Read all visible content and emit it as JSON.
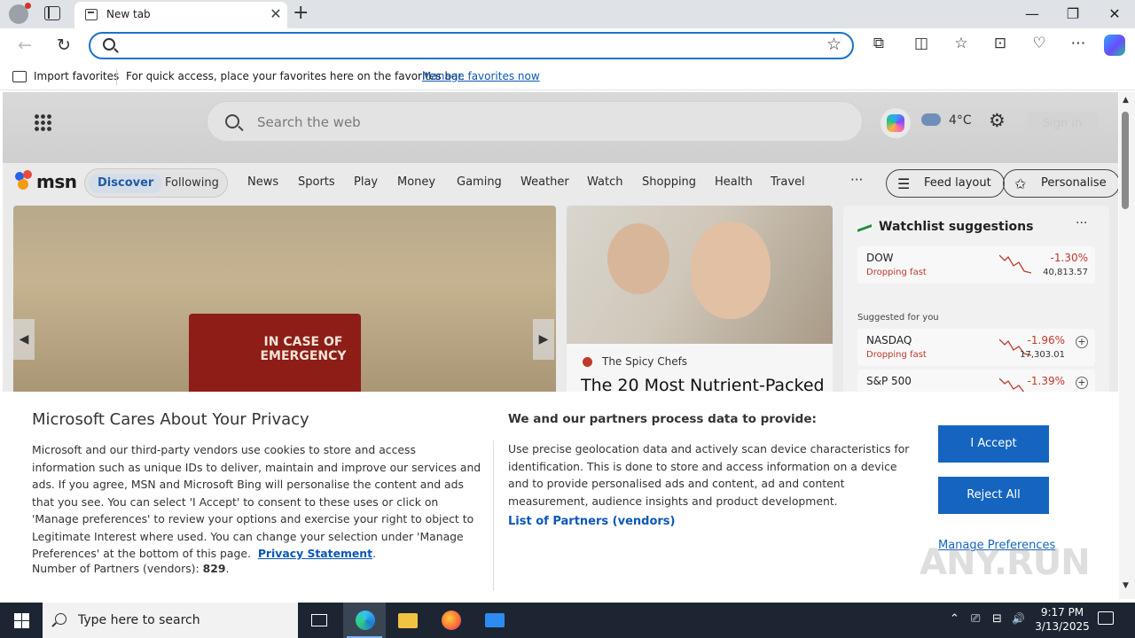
{
  "browser": {
    "tab_title": "New tab",
    "tab_close": "✕",
    "new_tab": "+",
    "window_controls": {
      "minimize": "—",
      "restore": "❐",
      "close": "✕"
    },
    "nav": {
      "back": "←",
      "refresh": "↻"
    },
    "address_placeholder": "",
    "favorite_star": "☆",
    "toolbar_icons": [
      "extensions-icon",
      "split-screen-icon",
      "favorites-icon",
      "collections-icon",
      "browser-essentials-icon",
      "more-icon",
      "copilot-icon"
    ],
    "toolbar_glyphs": {
      "extensions": "⧉",
      "split": "◫",
      "favorites": "☆",
      "collections": "⊡",
      "essentials": "♡",
      "more": "⋯"
    }
  },
  "favorites_bar": {
    "import_label": "Import favorites",
    "message": "For quick access, place your favorites here on the favorites bar.",
    "manage_link": "Manage favorites now"
  },
  "msn": {
    "search_placeholder": "Search the web",
    "weather_temp": "4°C",
    "signin_label": "Sign in",
    "brand": "msn",
    "tabs": [
      {
        "label": "Discover",
        "active": true
      },
      {
        "label": "Following",
        "active": false
      }
    ],
    "nav_links": [
      "News",
      "Sports",
      "Play",
      "Money",
      "Gaming",
      "Weather",
      "Watch",
      "Shopping",
      "Health",
      "Travel"
    ],
    "more_glyph": "···",
    "feed_layout_label": "Feed layout",
    "personalise_label": "Personalise",
    "hero": {
      "image_text": "IN CASE OF EMERGENCY",
      "prev": "◀",
      "next": "▶"
    },
    "card": {
      "source": "The Spicy Chefs",
      "title": "The 20 Most Nutrient-Packed"
    },
    "watchlist": {
      "title": "Watchlist suggestions",
      "more": "···",
      "suggested_label": "Suggested for you",
      "stocks": [
        {
          "name": "DOW",
          "status": "Dropping fast",
          "change": "-1.30%",
          "value": "40,813.57",
          "addable": false
        },
        {
          "name": "NASDAQ",
          "status": "Dropping fast",
          "change": "-1.96%",
          "value": "17,303.01",
          "addable": true
        },
        {
          "name": "S&P 500",
          "status": "",
          "change": "-1.39%",
          "value": "",
          "addable": true
        }
      ]
    }
  },
  "privacy": {
    "title": "Microsoft Cares About Your Privacy",
    "body": "Microsoft and our third-party vendors use cookies to store and access information such as unique IDs to deliver, maintain and improve our services and ads. If you agree, MSN and Microsoft Bing will personalise the content and ads that you see. You can select 'I Accept' to consent to these uses or click on 'Manage preferences' to review your options and exercise your right to object to Legitimate Interest where used.  You can change your selection under 'Manage Preferences' at the bottom of this page.",
    "privacy_link": "Privacy Statement",
    "partners_label": "Number of Partners (vendors):",
    "partners_count": "829",
    "purposes_title": "We and our partners process data to provide:",
    "purposes_body": "Use precise geolocation data and actively scan device characteristics for identification. This is done to store and access information on a device and to provide personalised ads and content, ad and content measurement, audience insights and product development.",
    "partners_link": "List of Partners (vendors)",
    "accept_label": "I Accept",
    "reject_label": "Reject All",
    "manage_label": "Manage Preferences",
    "watermark": "ANY.RUN"
  },
  "taskbar": {
    "search_placeholder": "Type here to search",
    "time": "9:17 PM",
    "date": "3/13/2025",
    "tray_glyphs": {
      "chevron": "⌃",
      "meet": "⎚",
      "network": "⊟",
      "volume": "🔊"
    }
  },
  "colors": {
    "accent": "#1565c0",
    "link": "#0b57b8",
    "negative": "#c0392b",
    "taskbar": "#1c2531"
  }
}
